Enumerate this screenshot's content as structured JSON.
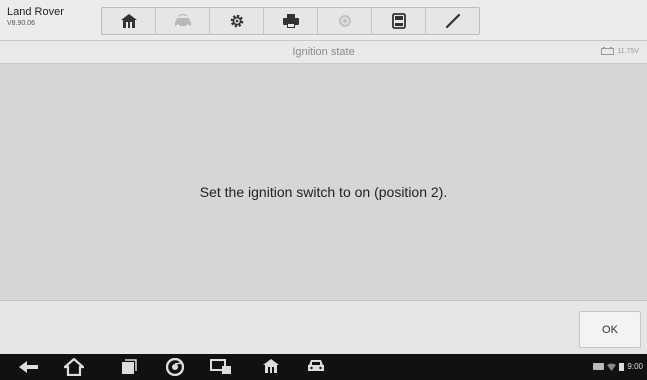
{
  "vehicle": {
    "name": "Land Rover",
    "version": "V8.90.06"
  },
  "toolbar": {
    "items": [
      {
        "icon": "home-icon",
        "enabled": true
      },
      {
        "icon": "vehicle-swap-icon",
        "enabled": false
      },
      {
        "icon": "settings-gear-icon",
        "enabled": true
      },
      {
        "icon": "printer-icon",
        "enabled": true
      },
      {
        "icon": "help-icon",
        "enabled": false
      },
      {
        "icon": "save-icon",
        "enabled": true
      },
      {
        "icon": "pen-icon",
        "enabled": true
      }
    ]
  },
  "page": {
    "title": "Ignition state",
    "battery_voltage": "11.75V"
  },
  "message": "Set the ignition switch to on (position 2).",
  "footer": {
    "ok_label": "OK"
  },
  "status_bar": {
    "time": "9:00"
  },
  "colors": {
    "background": "#d6d6d6",
    "nav_bar": "#111111",
    "icon_dark": "#333333",
    "icon_disabled": "#b5b5b5"
  }
}
